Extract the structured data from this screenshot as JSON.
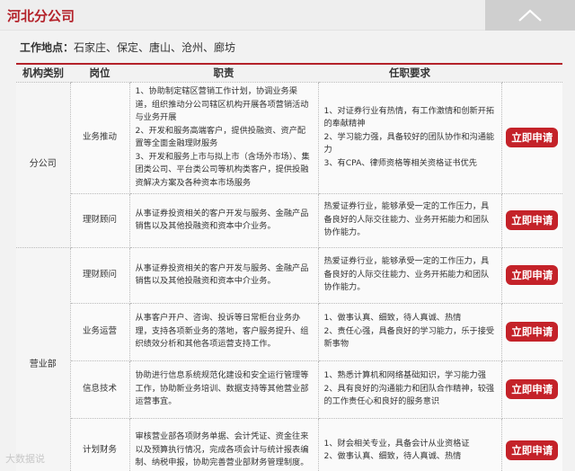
{
  "header": {
    "title": "河北分公司",
    "collapse_icon": "chevron-up-icon"
  },
  "location": {
    "label": "工作地点：",
    "value": "石家庄、保定、唐山、沧州、廊坊"
  },
  "table": {
    "columns": [
      "机构类别",
      "岗位",
      "职责",
      "任职要求",
      ""
    ],
    "groups": [
      {
        "category": "分公司",
        "rows": [
          {
            "position": "业务推动",
            "duties": [
              "1、协助制定辖区营销工作计划，协调业务渠道，组织推动分公司辖区机构开展各项营销活动与业务开展",
              "2、开发和服务高端客户，提供投融资、资产配置等全面金融理财服务",
              "3、开发和服务上市与拟上市（含场外市场）、集团类公司、平台类公司等机构类客户，提供投融资解决方案及各种资本市场服务"
            ],
            "requirements": [
              "1、对证券行业有热情，有工作激情和创新开拓的奉献精神",
              "2、学习能力强，具备较好的团队协作和沟通能力",
              "3、有CPA、律师资格等相关资格证书优先"
            ],
            "apply": "立即申请"
          },
          {
            "position": "理财顾问",
            "duties": [
              "从事证券投资相关的客户开发与服务、金融产品销售以及其他投融资和资本中介业务。"
            ],
            "requirements": [
              "热爱证券行业，能够承受一定的工作压力，具备良好的人际交往能力、业务开拓能力和团队协作能力。"
            ],
            "apply": "立即申请"
          }
        ]
      },
      {
        "category": "营业部",
        "rows": [
          {
            "position": "理财顾问",
            "duties": [
              "从事证券投资相关的客户开发与服务、金融产品销售以及其他投融资和资本中介业务。"
            ],
            "requirements": [
              "热爱证券行业，能够承受一定的工作压力，具备良好的人际交往能力、业务开拓能力和团队协作能力。"
            ],
            "apply": "立即申请"
          },
          {
            "position": "业务运营",
            "duties": [
              "从事客户开户、咨询、投诉等日常柜台业务办理，支持各项新业务的落地，客户服务提升、组织绩效分析和其他各项运营支持工作。"
            ],
            "requirements": [
              "1、做事认真、细致，待人真诚、热情",
              "2、责任心强，具备良好的学习能力，乐于接受新事物"
            ],
            "apply": "立即申请"
          },
          {
            "position": "信息技术",
            "duties": [
              "协助进行信息系统规范化建设和安全运行管理等工作，协助新业务培训、数据支持等其他营业部运营事宜。"
            ],
            "requirements": [
              "1、熟悉计算机和网络基础知识，学习能力强",
              "2、具有良好的沟通能力和团队合作精神，较强的工作责任心和良好的服务意识"
            ],
            "apply": "立即申请"
          },
          {
            "position": "计划财务",
            "duties": [
              "审核营业部各项财务单据、会计凭证、资金往来以及预算执行情况，完成各项会计与统计报表编制、纳税申报，协助完善营业部财务管理制度。"
            ],
            "requirements": [
              "1、财会相关专业，具备会计从业资格证",
              "2、做事认真、细致，待人真诚、热情"
            ],
            "apply": "立即申请"
          }
        ]
      }
    ]
  },
  "watermark": "大数据说"
}
